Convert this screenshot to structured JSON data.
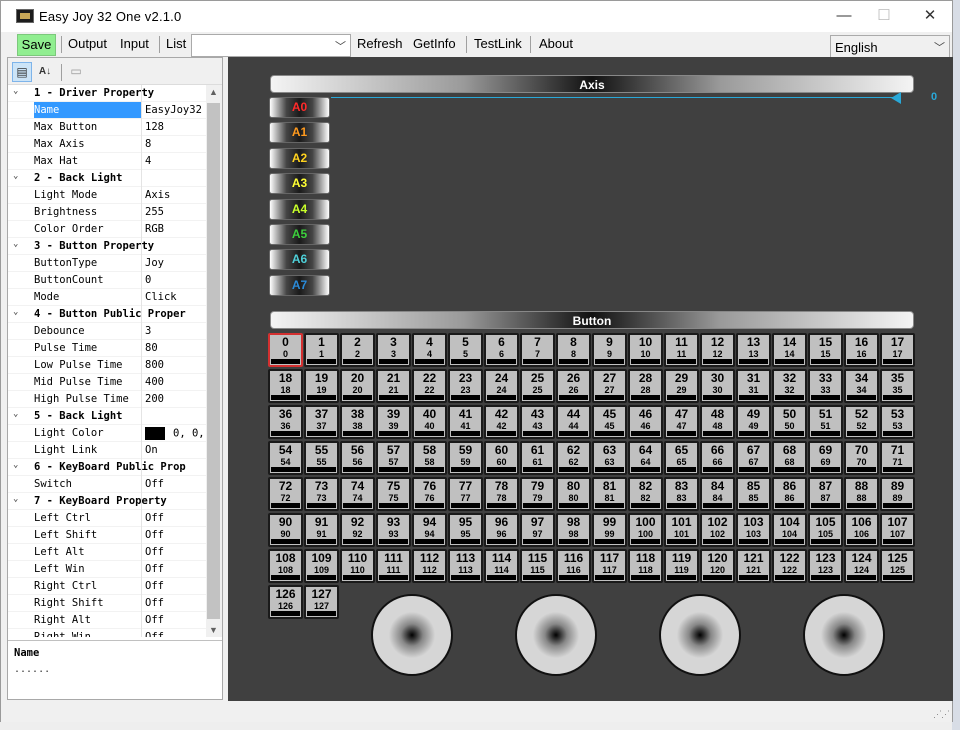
{
  "window": {
    "title": "Easy Joy 32 One v2.1.0",
    "min_label": "—",
    "max_label": "☐",
    "close_label": "✕"
  },
  "menu": {
    "save": "Save",
    "output": "Output",
    "input": "Input",
    "list": "List",
    "list_value": "",
    "refresh": "Refresh",
    "getinfo": "GetInfo",
    "testlink": "TestLink",
    "about": "About",
    "language": "English"
  },
  "toolbar": {
    "categorized_icon": "categorized-icon",
    "alpha_icon": "sort-alpha-icon",
    "pages_icon": "property-pages-icon"
  },
  "categories": [
    {
      "title": "1 - Driver Property",
      "items": [
        {
          "k": "Name",
          "v": "EasyJoy32"
        },
        {
          "k": "Max Button",
          "v": "128"
        },
        {
          "k": "Max Axis",
          "v": "8"
        },
        {
          "k": "Max Hat",
          "v": "4"
        }
      ]
    },
    {
      "title": "2 - Back Light",
      "items": [
        {
          "k": "Light Mode",
          "v": "Axis"
        },
        {
          "k": "Brightness",
          "v": "255"
        },
        {
          "k": "Color Order",
          "v": "RGB"
        }
      ]
    },
    {
      "title": "3 - Button Property",
      "items": [
        {
          "k": "ButtonType",
          "v": "Joy"
        },
        {
          "k": "ButtonCount",
          "v": "0"
        },
        {
          "k": "Mode",
          "v": "Click"
        }
      ]
    },
    {
      "title": "4 - Button Public Proper",
      "items": [
        {
          "k": "Debounce",
          "v": "3"
        },
        {
          "k": "Pulse Time",
          "v": "80"
        },
        {
          "k": "Low Pulse Time",
          "v": "800"
        },
        {
          "k": "Mid Pulse Time",
          "v": "400"
        },
        {
          "k": "High Pulse Time",
          "v": "200"
        }
      ]
    },
    {
      "title": "5 - Back Light",
      "items": [
        {
          "k": "Light Color",
          "v": "0, 0,",
          "color": "#000000"
        },
        {
          "k": "Light Link",
          "v": "On"
        }
      ]
    },
    {
      "title": "6 - KeyBoard Public Prop",
      "items": [
        {
          "k": "Switch",
          "v": "Off"
        }
      ]
    },
    {
      "title": "7 - KeyBoard Property",
      "items": [
        {
          "k": "Left Ctrl",
          "v": "Off"
        },
        {
          "k": "Left Shift",
          "v": "Off"
        },
        {
          "k": "Left Alt",
          "v": "Off"
        },
        {
          "k": "Left Win",
          "v": "Off"
        },
        {
          "k": "Right Ctrl",
          "v": "Off"
        },
        {
          "k": "Right Shift",
          "v": "Off"
        },
        {
          "k": "Right Alt",
          "v": "Off"
        },
        {
          "k": "Right Win",
          "v": "Off"
        }
      ]
    }
  ],
  "selected_property": "Name",
  "description": {
    "name": "Name",
    "text": "......"
  },
  "axis": {
    "header": "Axis",
    "value": "0",
    "buttons": [
      {
        "label": "A0",
        "color": "#ff2a2a"
      },
      {
        "label": "A1",
        "color": "#ff9a1e"
      },
      {
        "label": "A2",
        "color": "#ffd21e"
      },
      {
        "label": "A3",
        "color": "#ffff33"
      },
      {
        "label": "A4",
        "color": "#c8ff2a"
      },
      {
        "label": "A5",
        "color": "#3ccf3c"
      },
      {
        "label": "A6",
        "color": "#4ecfd8"
      },
      {
        "label": "A7",
        "color": "#2a8ad8"
      }
    ]
  },
  "button_section": {
    "header": "Button",
    "count": 128,
    "selected": 0
  },
  "hats": [
    "hat-0",
    "hat-1",
    "hat-2",
    "hat-3"
  ]
}
